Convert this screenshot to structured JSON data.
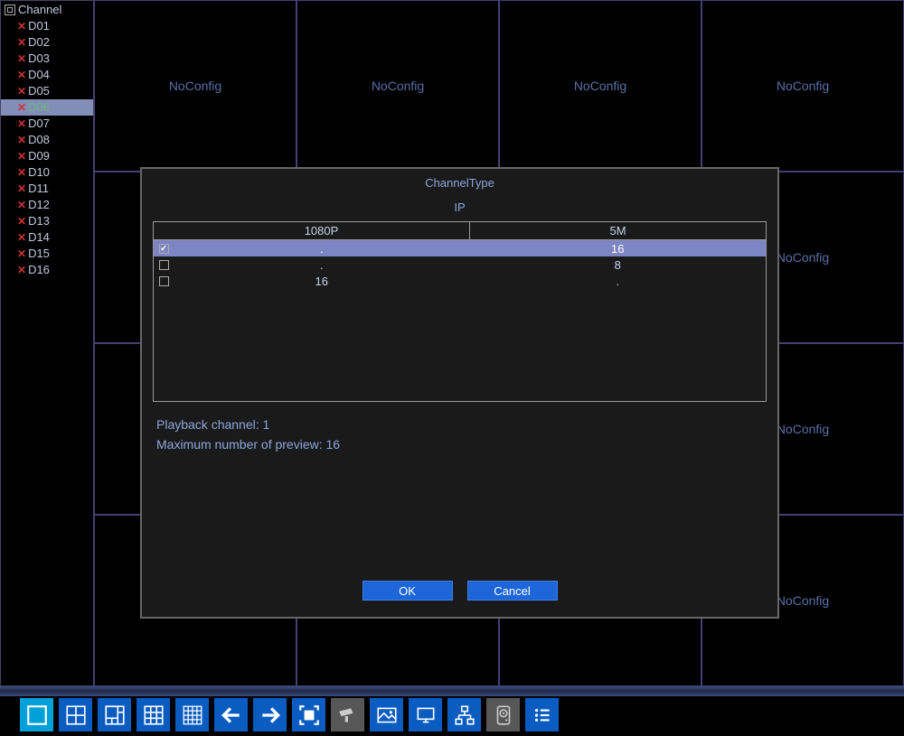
{
  "sidebar": {
    "header": "Channel",
    "items": [
      {
        "label": "D01",
        "selected": false
      },
      {
        "label": "D02",
        "selected": false
      },
      {
        "label": "D03",
        "selected": false
      },
      {
        "label": "D04",
        "selected": false
      },
      {
        "label": "D05",
        "selected": false
      },
      {
        "label": "D06",
        "selected": true
      },
      {
        "label": "D07",
        "selected": false
      },
      {
        "label": "D08",
        "selected": false
      },
      {
        "label": "D09",
        "selected": false
      },
      {
        "label": "D10",
        "selected": false
      },
      {
        "label": "D11",
        "selected": false
      },
      {
        "label": "D12",
        "selected": false
      },
      {
        "label": "D13",
        "selected": false
      },
      {
        "label": "D14",
        "selected": false
      },
      {
        "label": "D15",
        "selected": false
      },
      {
        "label": "D16",
        "selected": false
      }
    ]
  },
  "grid": {
    "cell_label": "NoConfig"
  },
  "dialog": {
    "title": "ChannelType",
    "subtitle": "IP",
    "columns": {
      "col1": "1080P",
      "col2": "5M"
    },
    "rows": [
      {
        "checked": true,
        "col1": ".",
        "col2": "16",
        "selected": true
      },
      {
        "checked": false,
        "col1": ".",
        "col2": "8",
        "selected": false
      },
      {
        "checked": false,
        "col1": "16",
        "col2": ".",
        "selected": false
      }
    ],
    "info": {
      "playback": "Playback channel: 1",
      "maxpreview": "Maximum number of preview: 16"
    },
    "buttons": {
      "ok": "OK",
      "cancel": "Cancel"
    }
  }
}
